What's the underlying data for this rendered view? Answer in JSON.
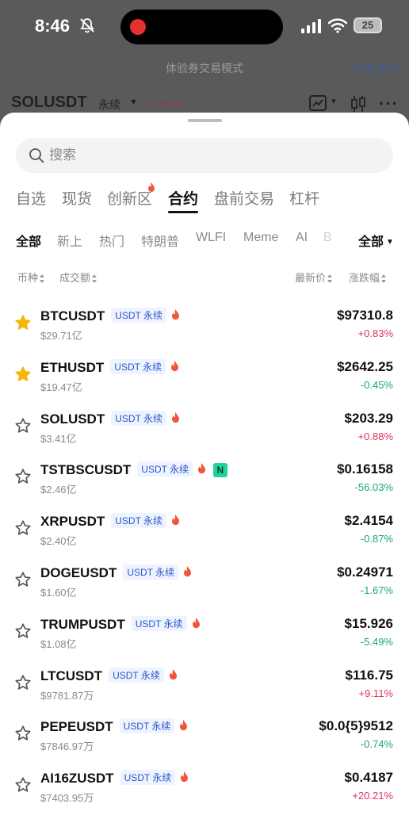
{
  "status_bar": {
    "time": "8:46",
    "battery": "25"
  },
  "background": {
    "banner_text": "体验券交易模式",
    "banner_exit": "点此退出",
    "symbol": "SOLUSDT",
    "contract_type": "永续",
    "change": "+0.90%"
  },
  "search": {
    "placeholder": "搜索"
  },
  "tabs": [
    {
      "label": "自选"
    },
    {
      "label": "现货"
    },
    {
      "label": "创新区"
    },
    {
      "label": "合约"
    },
    {
      "label": "盘前交易"
    },
    {
      "label": "杠杆"
    }
  ],
  "active_tab": "合约",
  "subtabs": [
    {
      "label": "全部"
    },
    {
      "label": "新上"
    },
    {
      "label": "热门"
    },
    {
      "label": "特朗普"
    },
    {
      "label": "WLFI"
    },
    {
      "label": "Meme"
    },
    {
      "label": "AI"
    },
    {
      "label": "B"
    }
  ],
  "subtab_filter": "全部",
  "columns": {
    "coin": "币种",
    "volume": "成交额",
    "price": "最新价",
    "change": "涨跌幅"
  },
  "badge_label": "USDT 永续",
  "new_badge": "N",
  "colors": {
    "up": "#e0335a",
    "down": "#1aa583",
    "star": "#f5b50a",
    "flame": "#f0563c",
    "badge_text": "#2a56c6"
  },
  "rows": [
    {
      "symbol": "BTCUSDT",
      "volume": "$29.71亿",
      "price": "$97310.8",
      "change": "+0.83%",
      "favorite": true
    },
    {
      "symbol": "ETHUSDT",
      "volume": "$19.47亿",
      "price": "$2642.25",
      "change": "-0.45%",
      "favorite": true
    },
    {
      "symbol": "SOLUSDT",
      "volume": "$3.41亿",
      "price": "$203.29",
      "change": "+0.88%",
      "favorite": false
    },
    {
      "symbol": "TSTBSCUSDT",
      "volume": "$2.46亿",
      "price": "$0.16158",
      "change": "-56.03%",
      "favorite": false,
      "is_new": true
    },
    {
      "symbol": "XRPUSDT",
      "volume": "$2.40亿",
      "price": "$2.4154",
      "change": "-0.87%",
      "favorite": false
    },
    {
      "symbol": "DOGEUSDT",
      "volume": "$1.60亿",
      "price": "$0.24971",
      "change": "-1.67%",
      "favorite": false
    },
    {
      "symbol": "TRUMPUSDT",
      "volume": "$1.08亿",
      "price": "$15.926",
      "change": "-5.49%",
      "favorite": false
    },
    {
      "symbol": "LTCUSDT",
      "volume": "$9781.87万",
      "price": "$116.75",
      "change": "+9.11%",
      "favorite": false
    },
    {
      "symbol": "PEPEUSDT",
      "volume": "$7846.97万",
      "price": "$0.0{5}9512",
      "change": "-0.74%",
      "favorite": false
    },
    {
      "symbol": "AI16ZUSDT",
      "volume": "$7403.95万",
      "price": "$0.4187",
      "change": "+20.21%",
      "favorite": false
    }
  ]
}
